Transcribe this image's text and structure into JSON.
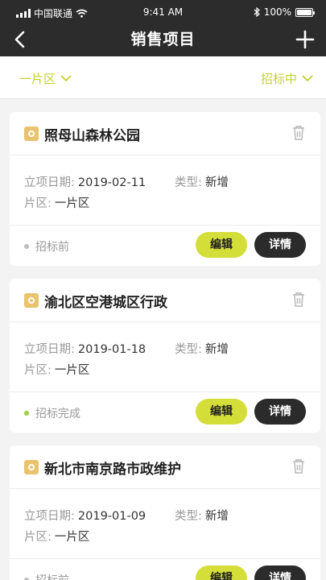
{
  "status_bar": {
    "carrier": "中国联通",
    "time": "9:41 AM",
    "battery": "100%"
  },
  "nav": {
    "title": "销售项目",
    "back_icon": "chevron-left-icon",
    "add_icon": "plus-icon"
  },
  "filters": {
    "left": "一片区",
    "right": "招标中"
  },
  "colors": {
    "accent": "#d4de38",
    "dark": "#2b2b2b",
    "header": "#2c2c2c",
    "icon": "#e9c36d"
  },
  "projects": [
    {
      "title": "照母山森林公园",
      "date_label": "立项日期:",
      "date": "2019-02-11",
      "type_label": "类型:",
      "type": "新增",
      "area_label": "片区:",
      "area": "一片区",
      "status": "招标前",
      "status_color": "#bdbdbd",
      "edit_label": "编辑",
      "detail_label": "详情"
    },
    {
      "title": "渝北区空港城区行政",
      "date_label": "立项日期:",
      "date": "2019-01-18",
      "type_label": "类型:",
      "type": "新增",
      "area_label": "片区:",
      "area": "一片区",
      "status": "招标完成",
      "status_color": "#9ccf3c",
      "edit_label": "编辑",
      "detail_label": "详情"
    },
    {
      "title": "新北市南京路市政维护",
      "date_label": "立项日期:",
      "date": "2019-01-09",
      "type_label": "类型:",
      "type": "新增",
      "area_label": "片区:",
      "area": "一片区",
      "status": "招标前",
      "status_color": "#bdbdbd",
      "edit_label": "编辑",
      "detail_label": "详情"
    }
  ]
}
